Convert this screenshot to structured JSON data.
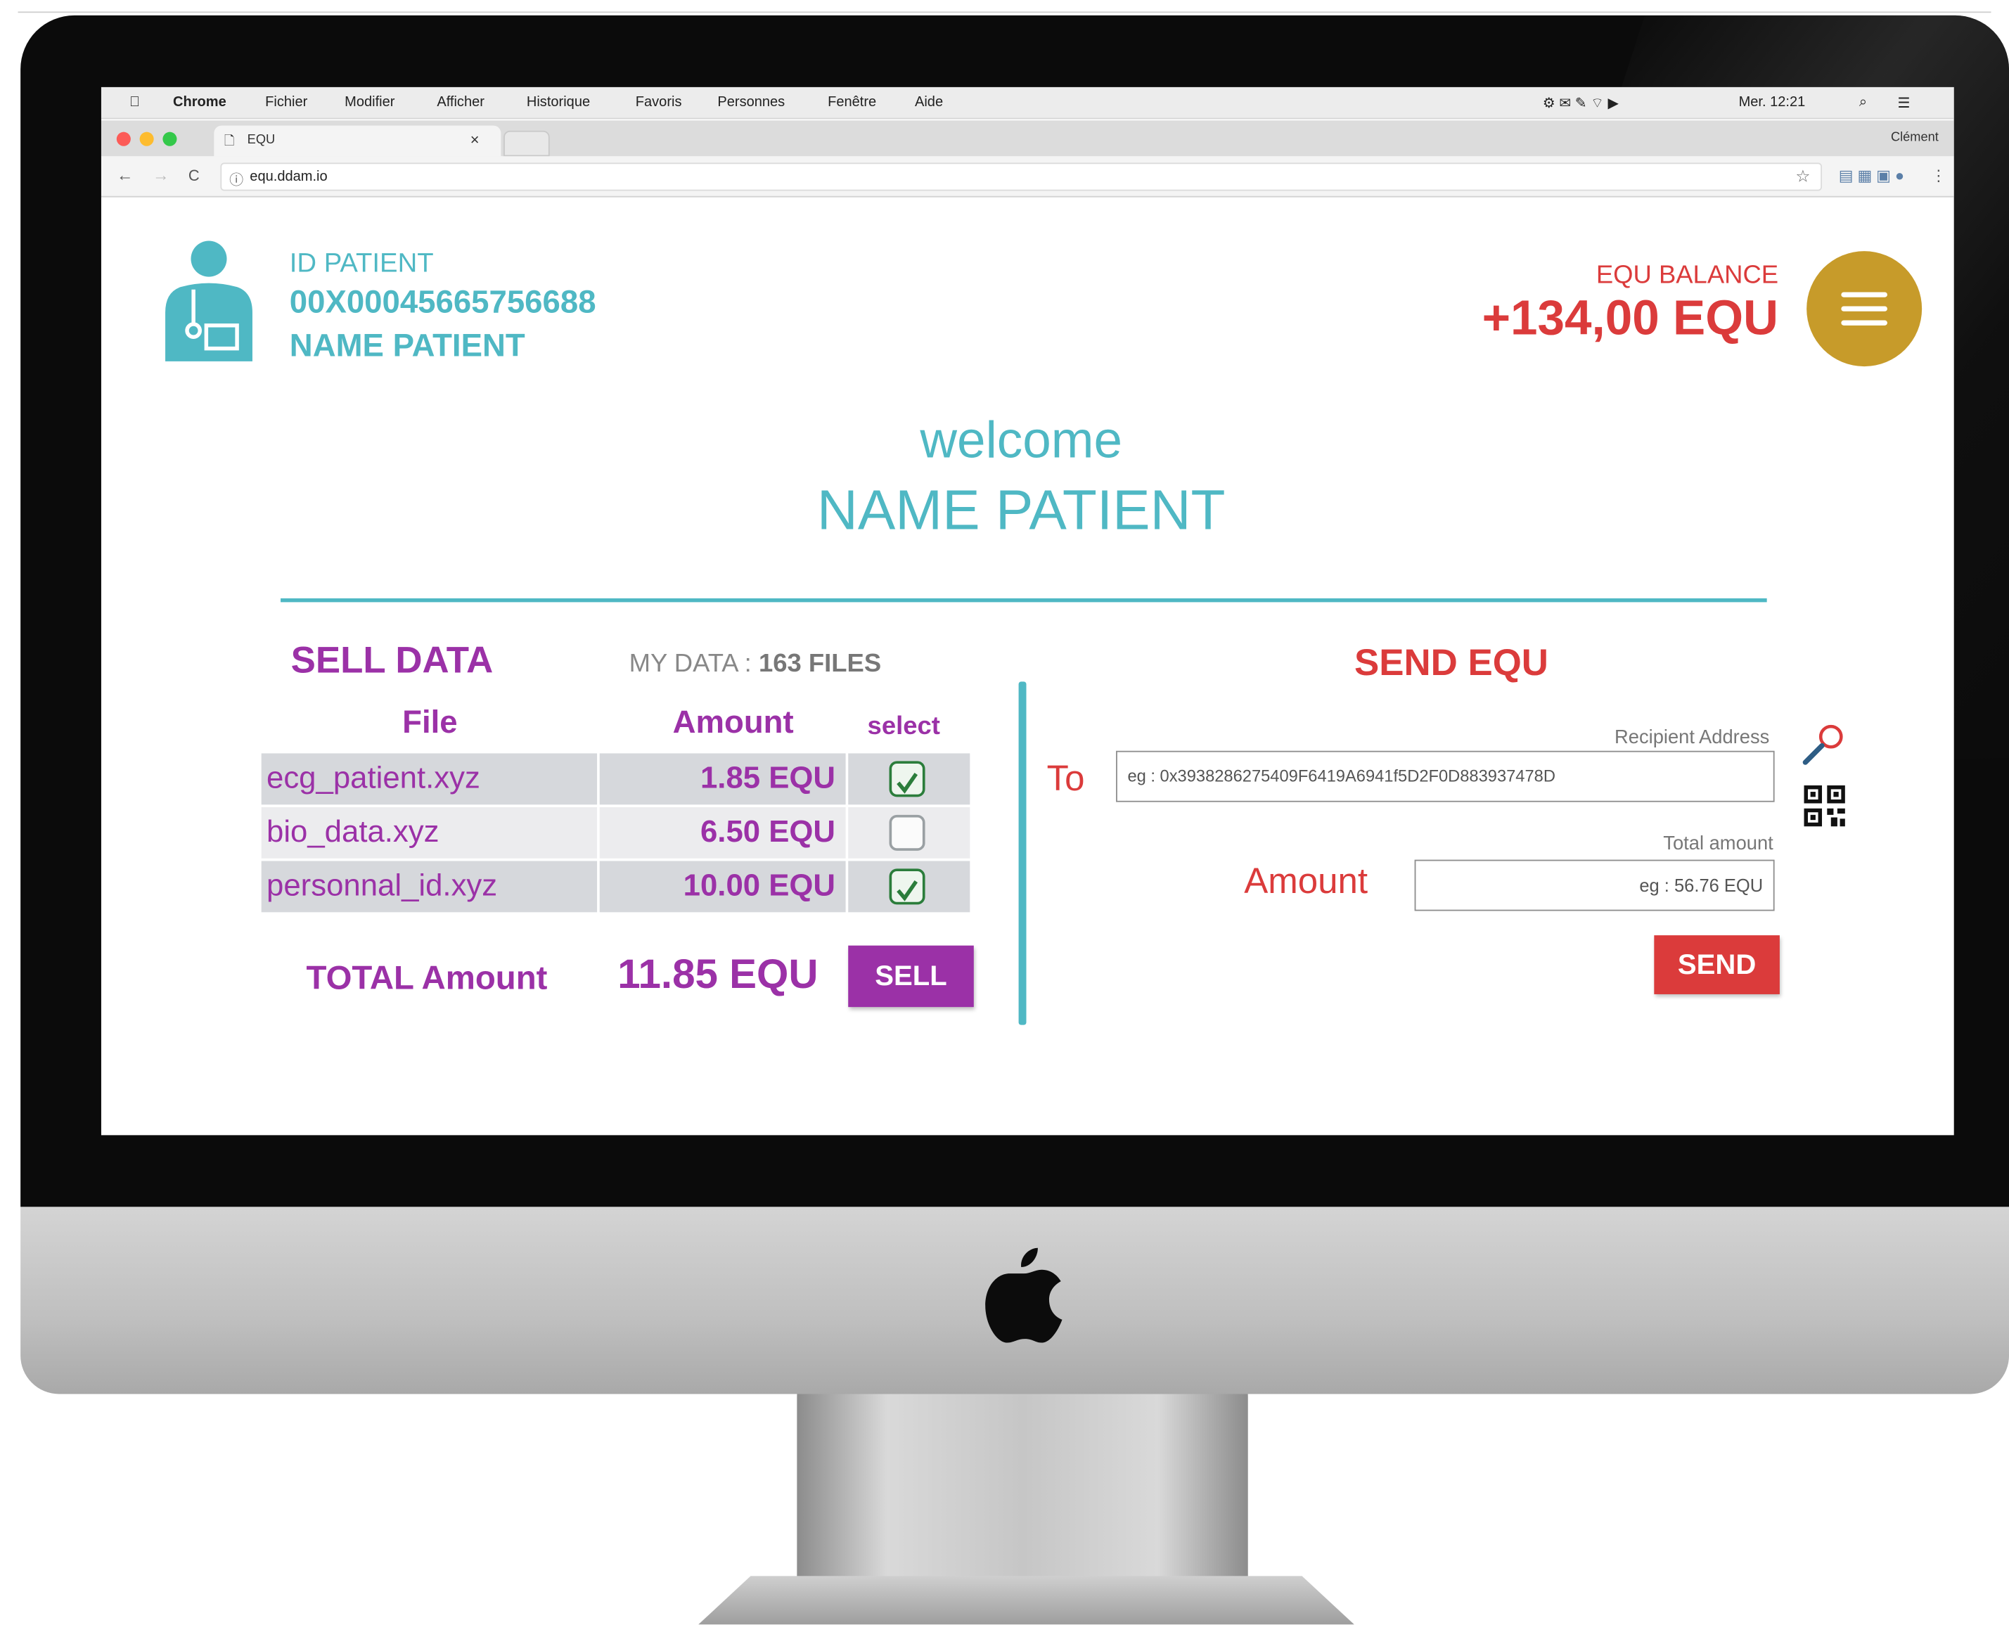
{
  "mac_menubar": {
    "apple": "",
    "items": [
      "Chrome",
      "Fichier",
      "Modifier",
      "Afficher",
      "Historique",
      "Favoris",
      "Personnes",
      "Fenêtre",
      "Aide"
    ],
    "status": "Mer. 12:21"
  },
  "browser": {
    "tab_title": "EQU",
    "tab_close": "×",
    "profile": "Clément",
    "url": "equ.ddam.io",
    "nav_back": "←",
    "nav_forward": "→",
    "reload": "C",
    "star": "☆"
  },
  "header": {
    "id_label": "ID PATIENT",
    "id_value": "00X00045665756688",
    "name": "NAME PATIENT",
    "balance_label": "EQU BALANCE",
    "balance_value": "+134,00 EQU"
  },
  "welcome": {
    "line1": "welcome",
    "line2": "NAME PATIENT"
  },
  "sell": {
    "title": "SELL DATA",
    "my_data_label": "MY DATA : ",
    "my_data_value": "163 FILES",
    "columns": [
      "File",
      "Amount",
      "select"
    ],
    "rows": [
      {
        "file": "ecg_patient.xyz",
        "amount": "1.85 EQU",
        "selected": true
      },
      {
        "file": "bio_data.xyz",
        "amount": "6.50 EQU",
        "selected": false
      },
      {
        "file": "personnal_id.xyz",
        "amount": "10.00 EQU",
        "selected": true
      }
    ],
    "total_label": "TOTAL Amount",
    "total_value": "11.85 EQU",
    "button": "SELL"
  },
  "send": {
    "title": "SEND EQU",
    "to_label": "To",
    "recipient_label": "Recipient Address",
    "recipient_placeholder": "eg : 0x3938286275409F6419A6941f5D2F0D883937478D",
    "amount_label": "Amount",
    "total_amount_label": "Total amount",
    "amount_placeholder": "eg : 56.76 EQU",
    "button": "SEND"
  },
  "colors": {
    "teal": "#4fb8c4",
    "purple": "#9b31a7",
    "red": "#db3b3b",
    "menu_gold": "#c79b2a"
  },
  "icons": [
    "apple-logo-icon",
    "patient-icon",
    "hamburger-menu-icon",
    "magnifier-icon",
    "qr-code-icon",
    "checkbox-checked-icon",
    "checkbox-empty-icon"
  ]
}
